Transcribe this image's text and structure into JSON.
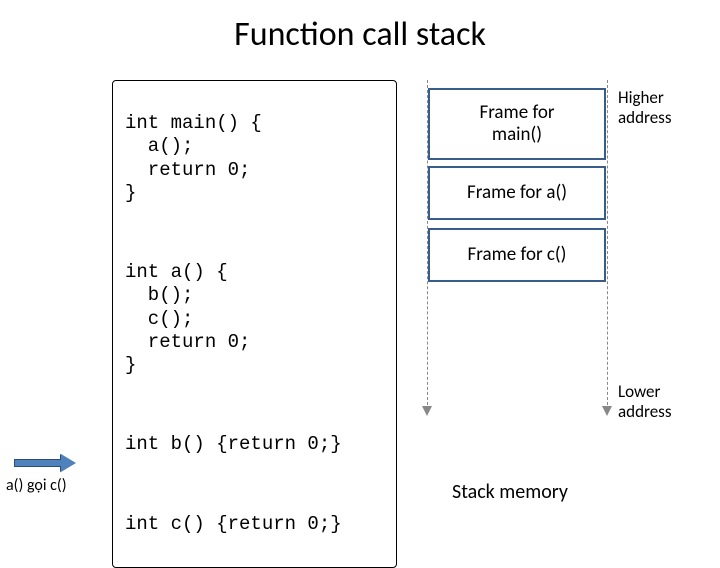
{
  "title": "Function call stack",
  "code": {
    "main": "int main() {\n  a();\n  return 0;\n}",
    "a": "int a() {\n  b();\n  c();\n  return 0;\n}",
    "b": "int b() {return 0;}",
    "c": "int c() {return 0;}"
  },
  "stack": {
    "frames": [
      {
        "label": "Frame for\nmain()"
      },
      {
        "label": "Frame for a()"
      },
      {
        "label": "Frame for c()"
      }
    ],
    "high_label": "Higher\naddress",
    "low_label": "Lower\naddress",
    "memory_label": "Stack memory"
  },
  "annotation": {
    "arrow_caption": "a() gọi c()"
  }
}
